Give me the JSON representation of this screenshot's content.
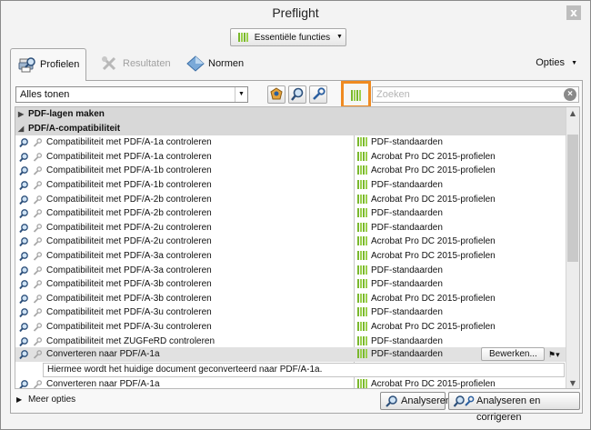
{
  "window": {
    "title": "Preflight",
    "close_label": "x"
  },
  "essential": {
    "label": "Essentiële functies"
  },
  "tabs": [
    {
      "label": "Profielen",
      "active": true
    },
    {
      "label": "Resultaten",
      "active": false
    },
    {
      "label": "Normen",
      "active": false
    }
  ],
  "options_label": "Opties",
  "filter": {
    "value": "Alles tonen"
  },
  "search": {
    "placeholder": "Zoeken"
  },
  "groups": [
    {
      "name": "PDF-lagen maken",
      "expanded": false
    },
    {
      "name": "PDF/A-compatibiliteit",
      "expanded": true
    }
  ],
  "rows": [
    {
      "name": "Compatibiliteit met PDF/A-1a controleren",
      "category": "PDF-standaarden"
    },
    {
      "name": "Compatibiliteit met PDF/A-1a controleren",
      "category": "Acrobat Pro DC 2015-profielen"
    },
    {
      "name": "Compatibiliteit met PDF/A-1b controleren",
      "category": "Acrobat Pro DC 2015-profielen"
    },
    {
      "name": "Compatibiliteit met PDF/A-1b controleren",
      "category": "PDF-standaarden"
    },
    {
      "name": "Compatibiliteit met PDF/A-2b controleren",
      "category": "Acrobat Pro DC 2015-profielen"
    },
    {
      "name": "Compatibiliteit met PDF/A-2b controleren",
      "category": "PDF-standaarden"
    },
    {
      "name": "Compatibiliteit met PDF/A-2u controleren",
      "category": "PDF-standaarden"
    },
    {
      "name": "Compatibiliteit met PDF/A-2u controleren",
      "category": "Acrobat Pro DC 2015-profielen"
    },
    {
      "name": "Compatibiliteit met PDF/A-3a controleren",
      "category": "Acrobat Pro DC 2015-profielen"
    },
    {
      "name": "Compatibiliteit met PDF/A-3a controleren",
      "category": "PDF-standaarden"
    },
    {
      "name": "Compatibiliteit met PDF/A-3b controleren",
      "category": "PDF-standaarden"
    },
    {
      "name": "Compatibiliteit met PDF/A-3b controleren",
      "category": "Acrobat Pro DC 2015-profielen"
    },
    {
      "name": "Compatibiliteit met PDF/A-3u controleren",
      "category": "PDF-standaarden"
    },
    {
      "name": "Compatibiliteit met PDF/A-3u controleren",
      "category": "Acrobat Pro DC 2015-profielen"
    },
    {
      "name": "Compatibiliteit met ZUGFeRD controleren",
      "category": "PDF-standaarden"
    }
  ],
  "selected_row": {
    "name": "Converteren naar PDF/A-1a",
    "category": "PDF-standaarden",
    "edit_label": "Bewerken...",
    "description": "Hiermee wordt het huidige document geconverteerd naar PDF/A-1a."
  },
  "last_row": {
    "name": "Converteren naar PDF/A-1a",
    "category": "Acrobat Pro DC 2015-profielen"
  },
  "more_options": "Meer opties",
  "buttons": {
    "analyze": "Analyseren",
    "analyze_fix": "Analyseren en corrigeren"
  },
  "colors": {
    "highlight": "#ef8a21",
    "bars": "#7ab82e"
  }
}
